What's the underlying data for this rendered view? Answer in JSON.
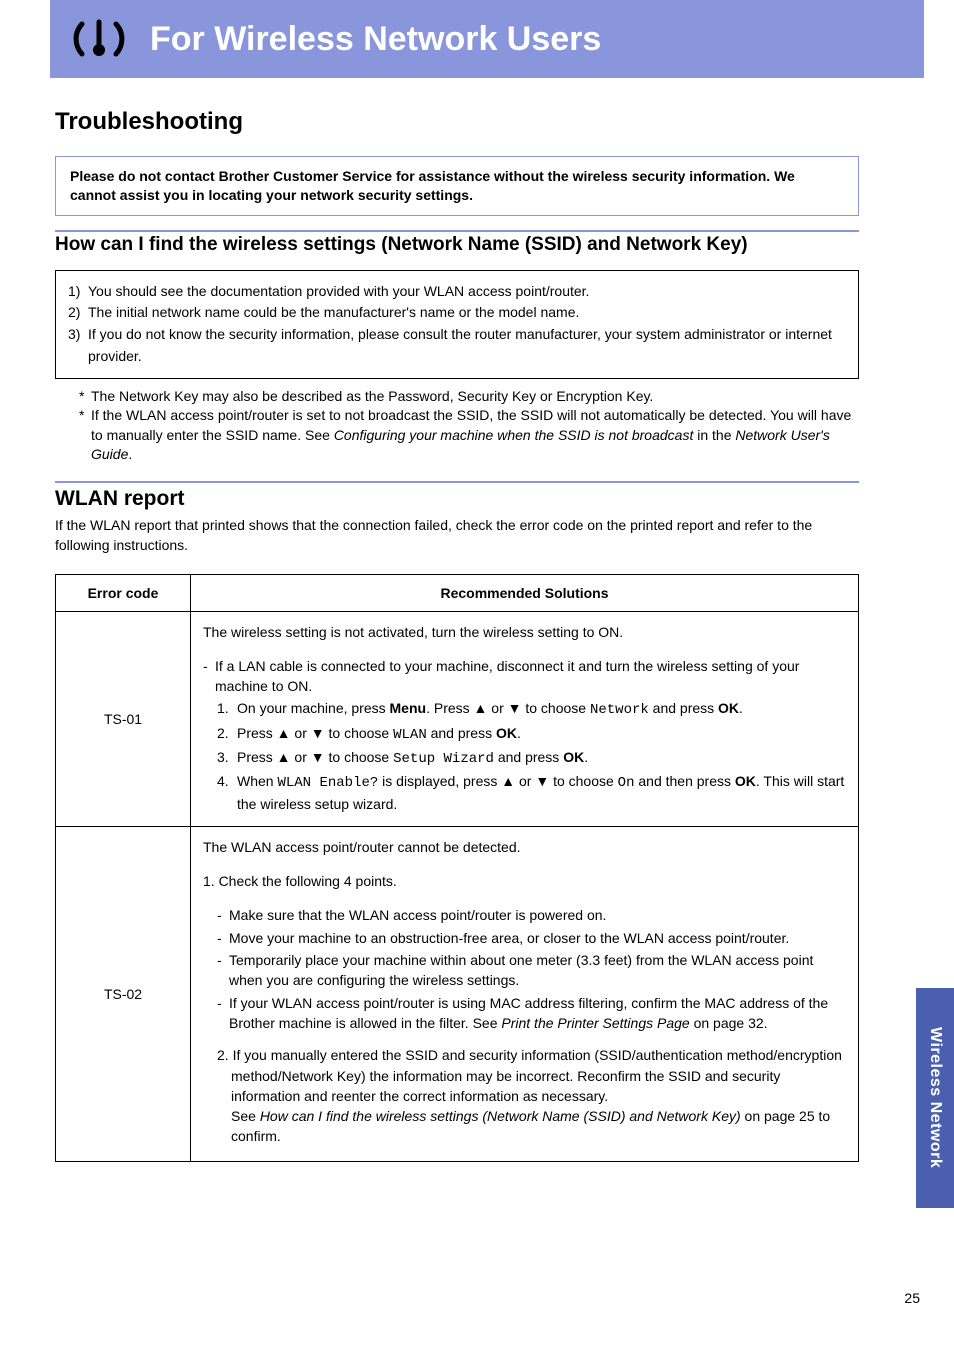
{
  "banner": {
    "title": "For Wireless Network Users"
  },
  "h1": "Troubleshooting",
  "notice": "Please do not contact Brother Customer Service for assistance without the wireless security information. We cannot assist you in locating your network security settings.",
  "h2_find": "How can I find the wireless settings (Network Name (SSID) and Network Key)",
  "steps": {
    "s1n": "1)",
    "s1": "You should see the documentation provided with your WLAN access point/router.",
    "s2n": "2)",
    "s2": "The initial network name could be the manufacturer's name or the model name.",
    "s3n": "3)",
    "s3": "If you do not know the security information, please consult the router manufacturer, your system administrator or internet provider."
  },
  "stars": {
    "a": "The Network Key may also be described as the Password, Security Key or Encryption Key.",
    "b_pre": "If the WLAN access point/router is set to not broadcast the SSID, the SSID will not automatically be detected. You will have to manually enter the SSID name. See ",
    "b_em": "Configuring your machine when the SSID is not broadcast",
    "b_mid": " in the ",
    "b_em2": "Network User's Guide",
    "b_post": "."
  },
  "wlan_h2": "WLAN report",
  "wlan_intro": "If the WLAN report that printed shows that the connection failed, check the error code on the printed report and refer to the following instructions.",
  "table": {
    "head_code": "Error code",
    "head_sol": "Recommended Solutions",
    "ts01": {
      "code": "TS-01",
      "l1": "The wireless setting is not activated, turn the wireless setting to ON.",
      "l2": "If a LAN cable is connected to your machine, disconnect it and turn the wireless setting of your machine to ON.",
      "l3a": "On your machine, press ",
      "l3b": "Menu",
      "l3c": ". Press ▲ or ▼ to choose ",
      "l3d": "Network",
      "l3e": " and press ",
      "l3f": "OK",
      "l3g": ".",
      "l4a": "Press ▲ or ▼ to choose ",
      "l4b": "WLAN",
      "l4c": " and press ",
      "l4d": "OK",
      "l4e": ".",
      "l5a": "Press ▲ or ▼ to choose ",
      "l5b": "Setup Wizard",
      "l5c": " and press ",
      "l5d": "OK",
      "l5e": ".",
      "l6a": "When ",
      "l6b": "WLAN Enable?",
      "l6c": " is displayed, press ▲ or ▼ to choose ",
      "l6d": "On",
      "l6e": " and then press ",
      "l6f": "OK",
      "l6g": ". This will start the wireless setup wizard."
    },
    "ts02": {
      "code": "TS-02",
      "l1": "The WLAN access point/router cannot be detected.",
      "l2": "1. Check the following 4 points.",
      "b1": "Make sure that the WLAN access point/router is powered on.",
      "b2": "Move your machine to an obstruction-free area, or closer to the WLAN access point/router.",
      "b3": "Temporarily place your machine within about one meter (3.3 feet) from the WLAN access point when you are configuring the wireless settings.",
      "b4a": "If your WLAN access point/router is using MAC address filtering, confirm the MAC address of the Brother machine is allowed in the filter. See ",
      "b4em": "Print the Printer Settings Page",
      "b4b": " on page 32.",
      "l3a": "2. If you manually entered the SSID and security information (SSID/authentication method/encryption method/Network Key) the information may be incorrect. Reconfirm the SSID and security information and reenter the correct information as necessary.",
      "l3b": "See ",
      "l3em": "How can I find the wireless settings (Network Name (SSID) and Network Key)",
      "l3c": " on page 25 to confirm."
    }
  },
  "sidetab": "Wireless Network",
  "page": "25"
}
